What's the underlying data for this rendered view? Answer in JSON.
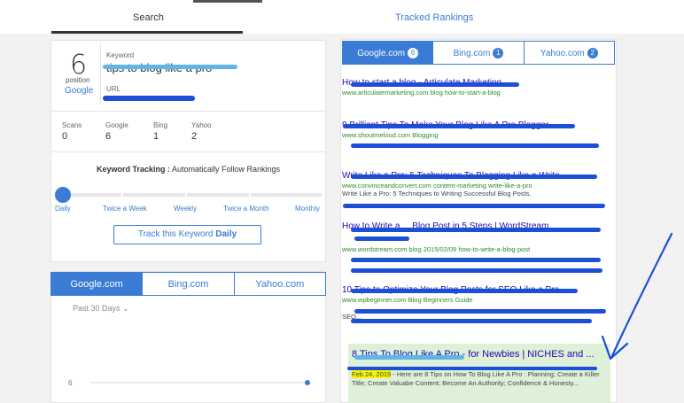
{
  "top_tabs": {
    "search": "Search",
    "tracked": "Tracked Rankings"
  },
  "position": {
    "number": "6",
    "label": "position",
    "engine": "Google"
  },
  "keyword": {
    "label": "Keyword",
    "value": "tips to blog like a pro",
    "url_label": "URL"
  },
  "stats": [
    {
      "label": "Scans",
      "value": "0"
    },
    {
      "label": "Google",
      "value": "6"
    },
    {
      "label": "Bing",
      "value": "1"
    },
    {
      "label": "Yahoo",
      "value": "2"
    }
  ],
  "tracking": {
    "title_bold": "Keyword Tracking :",
    "title_rest": " Automatically Follow Rankings",
    "options": [
      "Daily",
      "Twice a Week",
      "Weekly",
      "Twice a Month",
      "Monthly"
    ],
    "selected_index": 0,
    "button_text": "Track this Keyword ",
    "button_bold": "Daily"
  },
  "engine_tabs_chart": [
    "Google.com",
    "Bing.com",
    "Yahoo.com"
  ],
  "engine_tabs_results": [
    {
      "label": "Google.com",
      "count": "6"
    },
    {
      "label": "Bing.com",
      "count": "1"
    },
    {
      "label": "Yahoo.com",
      "count": "2"
    }
  ],
  "chart": {
    "range_label": "Past 30 Days",
    "y_tick": "6"
  },
  "chart_data": {
    "type": "line",
    "title": "",
    "x": [
      "Past 30 Days"
    ],
    "series": [
      {
        "name": "",
        "values": [
          6
        ]
      }
    ],
    "ylabel": "",
    "xlabel": ""
  },
  "results": [
    {
      "title": "How to start a blog - Articulate Marketing",
      "url": "www.articulatemarketing.com blog how-to-start-a-blog",
      "snippet": ""
    },
    {
      "title": "9 Brilliant Tips To Make Your Blog Like A Pro Blogger",
      "url": "www.shoutmeloud.com Blogging",
      "snippet": ""
    },
    {
      "title": "Write Like a Pro: 5 Techniques To Blogging Like a Write ...",
      "url": "www.convinceandconvert.com content-marketing write-like-a-pro",
      "snippet": "Write Like a Pro: 5 Techniques to Writing Successful Blog Posts."
    },
    {
      "title": "How to Write a ... Blog Post in 5 Steps | WordStream",
      "url": "www.wordstream.com blog 2015/02/09 how-to-write-a-blog-post",
      "snippet": ""
    },
    {
      "title": "10 Tips to Optimize Your Blog Posts for SEO Like a Pro",
      "url": "www.wpbeginner.com Blog Beginners Guide",
      "snippet": "SEO..."
    },
    {
      "title": "8 Tips To Blog Like A Pro - for Newbies | NICHES and ...",
      "url": "",
      "date": "Feb 24, 2019",
      "snippet": " - Here are 8 Tips on How To Blog Like A Pro : Planning; Create a Killer Title; Create Valuabe Content; Become An Authority; Confidence & Honesty..."
    }
  ]
}
